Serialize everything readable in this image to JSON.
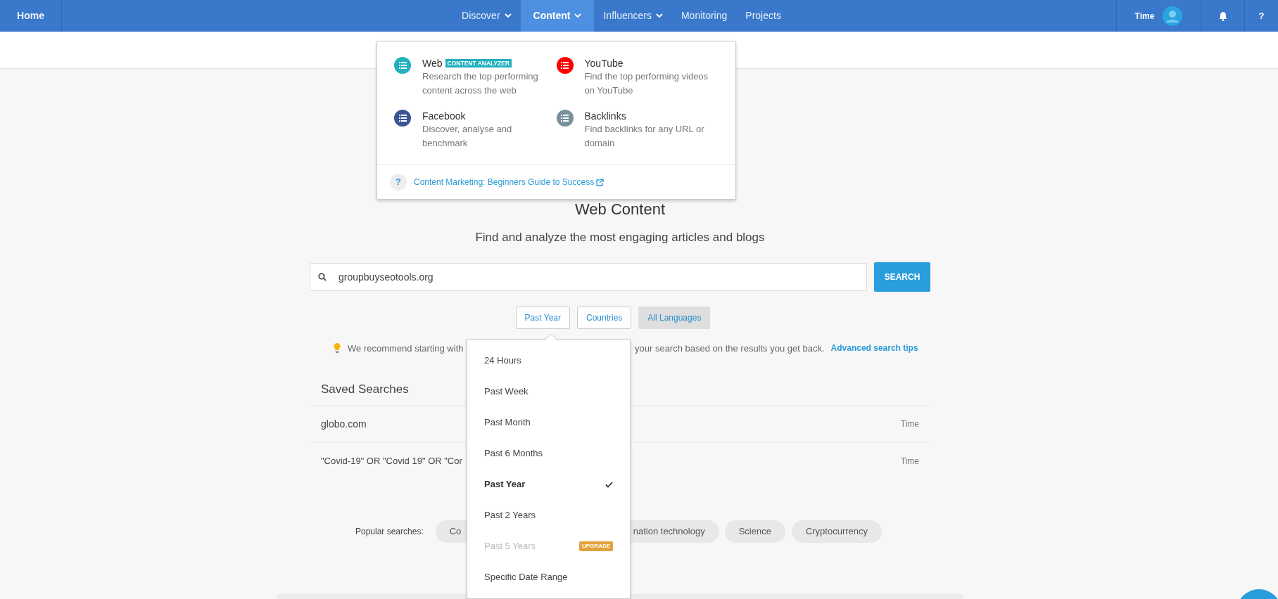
{
  "navbar": {
    "home": "Home",
    "items": [
      {
        "label": "Discover",
        "caret": true,
        "selected": false
      },
      {
        "label": "Content",
        "caret": true,
        "selected": true
      },
      {
        "label": "Influencers",
        "caret": true,
        "selected": false
      },
      {
        "label": "Monitoring",
        "caret": false,
        "selected": false
      },
      {
        "label": "Projects",
        "caret": false,
        "selected": false
      }
    ],
    "user": "Time",
    "help": "?"
  },
  "content_menu": {
    "items": [
      {
        "title": "Web",
        "badge": "CONTENT ANALYZER",
        "description": "Research the top performing content across the web",
        "color": "#22b0bf"
      },
      {
        "title": "YouTube",
        "description": "Find the top performing videos on YouTube",
        "color": "#ff0000"
      },
      {
        "title": "Facebook",
        "description": "Discover, analyse and benchmark",
        "color": "#3b5594"
      },
      {
        "title": "Backlinks",
        "description": "Find backlinks for any URL or domain",
        "color": "#78909c"
      }
    ],
    "footer_icon": "?",
    "footer_link": "Content Marketing: Beginners Guide to Success"
  },
  "main": {
    "title": "Web Content",
    "subtitle": "Find and analyze the most engaging articles and blogs",
    "search": {
      "value": "groupbuyseotools.org",
      "button": "SEARCH"
    },
    "filters": [
      {
        "label": "Past Year",
        "highlighted": false
      },
      {
        "label": "Countries",
        "highlighted": false
      },
      {
        "label": "All Languages",
        "highlighted": true
      }
    ],
    "tip": {
      "text_before": "We recommend starting with",
      "text_after": "your search based on the results you get back.",
      "link": "Advanced search tips"
    },
    "saved_searches": {
      "title": "Saved Searches",
      "rows": [
        {
          "query": "globo.com",
          "owner": "Time"
        },
        {
          "query": "\"Covid-19\" OR \"Covid 19\" OR \"Cor",
          "owner": "Time"
        }
      ]
    },
    "popular": {
      "label": "Popular searches:",
      "chips": [
        "Co",
        "nation technology",
        "Science",
        "Cryptocurrency"
      ]
    }
  },
  "time_menu": {
    "items": [
      {
        "label": "24 Hours",
        "selected": false,
        "disabled": false
      },
      {
        "label": "Past Week",
        "selected": false,
        "disabled": false
      },
      {
        "label": "Past Month",
        "selected": false,
        "disabled": false
      },
      {
        "label": "Past 6 Months",
        "selected": false,
        "disabled": false
      },
      {
        "label": "Past Year",
        "selected": true,
        "disabled": false
      },
      {
        "label": "Past 2 Years",
        "selected": false,
        "disabled": false
      },
      {
        "label": "Past 5 Years",
        "selected": false,
        "disabled": true,
        "badge": "UPGRADE"
      },
      {
        "label": "Specific Date Range",
        "selected": false,
        "disabled": false
      }
    ]
  }
}
